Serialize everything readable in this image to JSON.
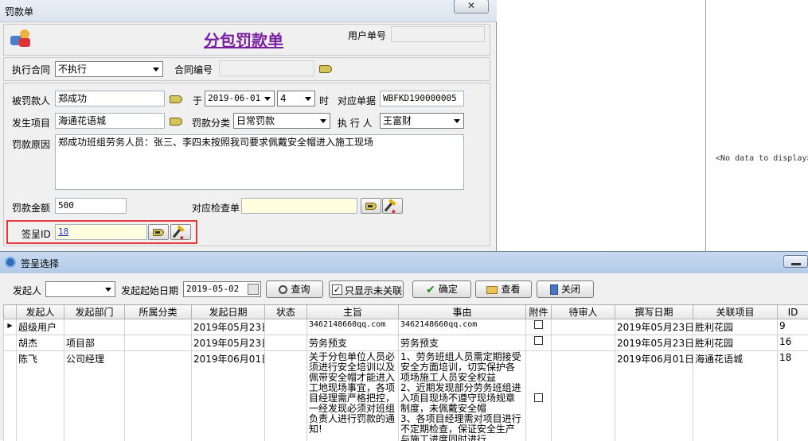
{
  "bg_window": {
    "title": "罚款单",
    "close_label": "✕",
    "form_title": "分包罚款单",
    "user_no_label": "用户单号",
    "user_no_value": "",
    "exec_contract_label": "执行合同",
    "exec_contract_value": "不执行",
    "contract_no_label": "合同编号",
    "contract_no_value": "",
    "penalized_label": "被罚款人",
    "penalized_value": "郑成功",
    "on_label": "于",
    "date_value": "2019-06-01",
    "hour_value": "4",
    "hour_unit": "时",
    "ref_doc_label": "对应单据",
    "ref_doc_value": "WBFKD190000005",
    "project_label": "发生项目",
    "project_value": "海通花语城",
    "category_label": "罚款分类",
    "category_value": "日常罚款",
    "executor_label": "执 行 人",
    "executor_value": "王富财",
    "reason_label": "罚款原因",
    "reason_value": "郑成功班组劳务人员：张三、李四未按照我司要求佩戴安全帽进入施工现场",
    "amount_label": "罚款金额",
    "amount_value": "500",
    "inspection_label": "对应检查单",
    "inspection_value": "",
    "sign_label": "签呈ID",
    "sign_value": "18",
    "highlight_color": "#e53a3a"
  },
  "right_panel": {
    "no_data_text": "<No data to display>"
  },
  "dialog": {
    "title": "签呈选择",
    "initiator_label": "发起人",
    "initiator_value": "",
    "start_date_label": "发起起始日期",
    "start_date_value": "2019-05-02",
    "query_label": "查询",
    "only_unlinked_label": "只显示未关联",
    "only_unlinked_checked": true,
    "confirm_label": "确定",
    "view_label": "查看",
    "close_label": "关闭",
    "columns": [
      "发起人",
      "发起部门",
      "所属分类",
      "发起日期",
      "状态",
      "主旨",
      "事由",
      "附件",
      "待审人",
      "撰写日期",
      "关联项目",
      "ID"
    ],
    "rows": [
      {
        "current": true,
        "initiator": "超级用户",
        "dept": "",
        "category": "",
        "date": "2019年05月23日",
        "status": "",
        "subject": "3462148660qq.com",
        "reason": "3462148660qq.com",
        "pending": "",
        "write_date": "2019年05月23日",
        "project": "胜利花园",
        "id": "9"
      },
      {
        "current": false,
        "initiator": "胡杰",
        "dept": "项目部",
        "category": "",
        "date": "2019年05月23日",
        "status": "",
        "subject": "劳务预支",
        "reason": "劳务预支",
        "pending": "",
        "write_date": "2019年05月23日",
        "project": "胜利花园",
        "id": "16"
      },
      {
        "current": false,
        "initiator": "陈飞",
        "dept": "公司经理",
        "category": "",
        "date": "2019年06月01日",
        "status": "",
        "subject": "关于分包单位人员必须进行安全培训以及佩带安全帽才能进入工地现场事宜，各项目经理需严格把控，一经发现必须对班组负责人进行罚款的通知!",
        "reason": "1、劳务班组人员需定期接受安全方面培训，切实保护各项场施工人员安全权益\n2、近期发现部分劳务班组进入项目现场不遵守现场规章制度，未佩戴安全帽\n3、各项目经理需对项目进行不定期检查，保证安全生产与施工进度同时进行",
        "pending": "",
        "write_date": "2019年06月01日",
        "project": "海通花语城",
        "id": "18"
      }
    ]
  }
}
